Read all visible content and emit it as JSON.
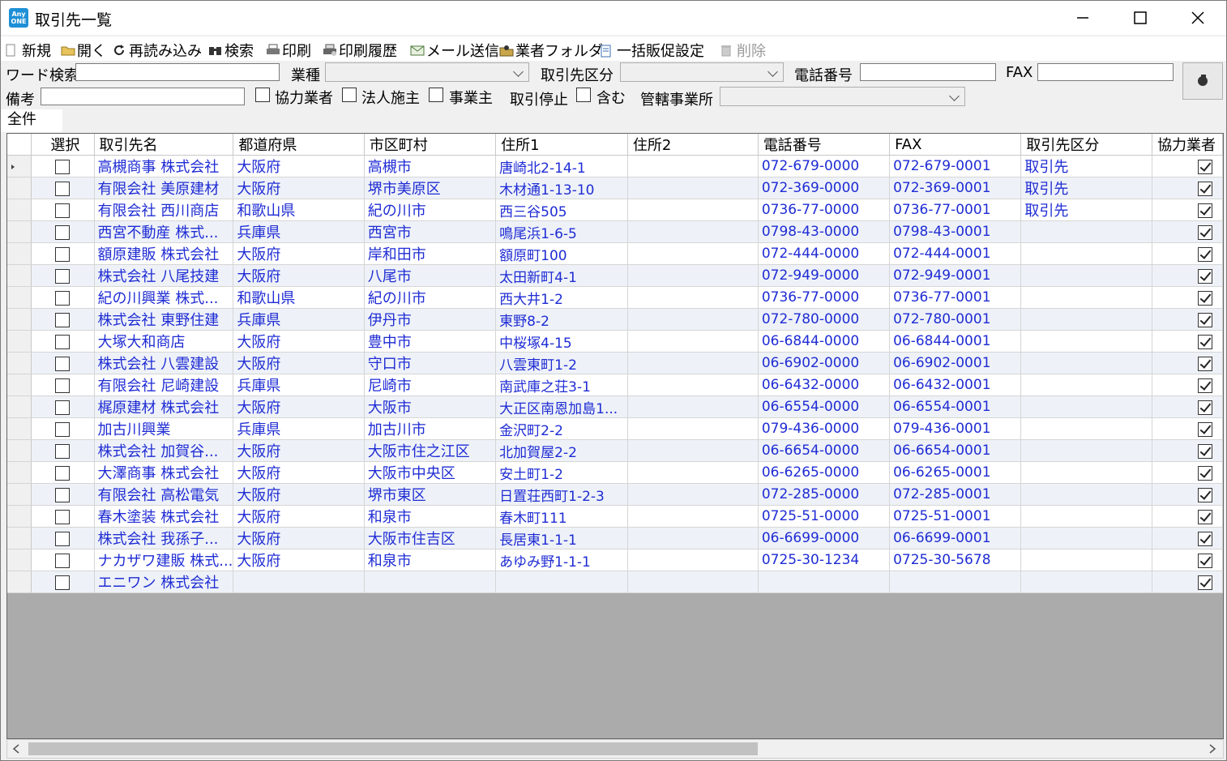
{
  "window": {
    "title": "取引先一覧",
    "app_icon_text": "Any ONE"
  },
  "toolbar": [
    {
      "label": "新規",
      "icon": "new-icon",
      "enabled": true
    },
    {
      "label": "開く",
      "icon": "folder-open-icon",
      "enabled": true
    },
    {
      "label": "再読み込み",
      "icon": "refresh-icon",
      "enabled": true
    },
    {
      "label": "検索",
      "icon": "binoculars-icon",
      "enabled": true
    },
    {
      "label": "印刷",
      "icon": "printer-icon",
      "enabled": true
    },
    {
      "label": "印刷履歴",
      "icon": "print-history-icon",
      "enabled": true
    },
    {
      "label": "メール送信",
      "icon": "mail-icon",
      "enabled": true
    },
    {
      "label": "業者フォルダ",
      "icon": "vendor-folder-icon",
      "enabled": true
    },
    {
      "label": "一括販促設定",
      "icon": "bulk-promo-icon",
      "enabled": true
    },
    {
      "label": "削除",
      "icon": "trash-icon",
      "enabled": false
    }
  ],
  "filters": {
    "word_search_label": "ワード検索",
    "word_search_value": "",
    "industry_label": "業種",
    "industry_value": "",
    "category_label": "取引先区分",
    "category_value": "",
    "phone_label": "電話番号",
    "phone_value": "",
    "fax_label": "FAX",
    "fax_value": "",
    "notes_label": "備考",
    "notes_value": "",
    "partner_label": "協力業者",
    "partner_checked": false,
    "corporate_label": "法人施主",
    "corporate_checked": false,
    "business_label": "事業主",
    "business_checked": false,
    "suspended_label": "取引停止",
    "include_label": "含む",
    "include_checked": false,
    "office_label": "管轄事業所",
    "office_value": ""
  },
  "tab": {
    "label": "全件"
  },
  "table": {
    "columns": [
      "選択",
      "取引先名",
      "都道府県",
      "市区町村",
      "住所1",
      "住所2",
      "電話番号",
      "FAX",
      "取引先区分",
      "協力業者"
    ],
    "rows": [
      {
        "selected": false,
        "name": "高槻商事 株式会社",
        "pref": "大阪府",
        "city": "高槻市",
        "addr1": "唐崎北2-14-1",
        "addr2": "",
        "tel": "072-679-0000",
        "fax": "072-679-0001",
        "category": "取引先",
        "partner": true
      },
      {
        "selected": false,
        "name": "有限会社 美原建材",
        "pref": "大阪府",
        "city": "堺市美原区",
        "addr1": "木材通1-13-10",
        "addr2": "",
        "tel": "072-369-0000",
        "fax": "072-369-0001",
        "category": "取引先",
        "partner": true
      },
      {
        "selected": false,
        "name": "有限会社 西川商店",
        "pref": "和歌山県",
        "city": "紀の川市",
        "addr1": "西三谷505",
        "addr2": "",
        "tel": "0736-77-0000",
        "fax": "0736-77-0001",
        "category": "取引先",
        "partner": true
      },
      {
        "selected": false,
        "name": "西宮不動産 株式...",
        "pref": "兵庫県",
        "city": "西宮市",
        "addr1": "鳴尾浜1-6-5",
        "addr2": "",
        "tel": "0798-43-0000",
        "fax": "0798-43-0001",
        "category": "",
        "partner": true
      },
      {
        "selected": false,
        "name": "額原建販 株式会社",
        "pref": "大阪府",
        "city": "岸和田市",
        "addr1": "額原町100",
        "addr2": "",
        "tel": "072-444-0000",
        "fax": "072-444-0001",
        "category": "",
        "partner": true
      },
      {
        "selected": false,
        "name": "株式会社 八尾技建",
        "pref": "大阪府",
        "city": "八尾市",
        "addr1": "太田新町4-1",
        "addr2": "",
        "tel": "072-949-0000",
        "fax": "072-949-0001",
        "category": "",
        "partner": true
      },
      {
        "selected": false,
        "name": "紀の川興業 株式...",
        "pref": "和歌山県",
        "city": "紀の川市",
        "addr1": "西大井1-2",
        "addr2": "",
        "tel": "0736-77-0000",
        "fax": "0736-77-0001",
        "category": "",
        "partner": true
      },
      {
        "selected": false,
        "name": "株式会社 東野住建",
        "pref": "兵庫県",
        "city": "伊丹市",
        "addr1": "東野8-2",
        "addr2": "",
        "tel": "072-780-0000",
        "fax": "072-780-0001",
        "category": "",
        "partner": true
      },
      {
        "selected": false,
        "name": "大塚大和商店",
        "pref": "大阪府",
        "city": "豊中市",
        "addr1": "中桜塚4-15",
        "addr2": "",
        "tel": "06-6844-0000",
        "fax": "06-6844-0001",
        "category": "",
        "partner": true
      },
      {
        "selected": false,
        "name": "株式会社 八雲建設",
        "pref": "大阪府",
        "city": "守口市",
        "addr1": "八雲東町1-2",
        "addr2": "",
        "tel": "06-6902-0000",
        "fax": "06-6902-0001",
        "category": "",
        "partner": true
      },
      {
        "selected": false,
        "name": "有限会社 尼崎建設",
        "pref": "兵庫県",
        "city": "尼崎市",
        "addr1": "南武庫之荘3-1",
        "addr2": "",
        "tel": "06-6432-0000",
        "fax": "06-6432-0001",
        "category": "",
        "partner": true
      },
      {
        "selected": false,
        "name": "梶原建材 株式会社",
        "pref": "大阪府",
        "city": "大阪市",
        "addr1": "大正区南恩加島1...",
        "addr2": "",
        "tel": "06-6554-0000",
        "fax": "06-6554-0001",
        "category": "",
        "partner": true
      },
      {
        "selected": false,
        "name": "加古川興業",
        "pref": "兵庫県",
        "city": "加古川市",
        "addr1": "金沢町2-2",
        "addr2": "",
        "tel": "079-436-0000",
        "fax": "079-436-0001",
        "category": "",
        "partner": true
      },
      {
        "selected": false,
        "name": "株式会社 加賀谷...",
        "pref": "大阪府",
        "city": "大阪市住之江区",
        "addr1": "北加賀屋2-2",
        "addr2": "",
        "tel": "06-6654-0000",
        "fax": "06-6654-0001",
        "category": "",
        "partner": true
      },
      {
        "selected": false,
        "name": "大澤商事 株式会社",
        "pref": "大阪府",
        "city": "大阪市中央区",
        "addr1": "安土町1-2",
        "addr2": "",
        "tel": "06-6265-0000",
        "fax": "06-6265-0001",
        "category": "",
        "partner": true
      },
      {
        "selected": false,
        "name": "有限会社 高松電気",
        "pref": "大阪府",
        "city": "堺市東区",
        "addr1": "日置荘西町1-2-3",
        "addr2": "",
        "tel": "072-285-0000",
        "fax": "072-285-0001",
        "category": "",
        "partner": true
      },
      {
        "selected": false,
        "name": "春木塗装 株式会社",
        "pref": "大阪府",
        "city": "和泉市",
        "addr1": "春木町111",
        "addr2": "",
        "tel": "0725-51-0000",
        "fax": "0725-51-0001",
        "category": "",
        "partner": true
      },
      {
        "selected": false,
        "name": "株式会社 我孫子...",
        "pref": "大阪府",
        "city": "大阪市住吉区",
        "addr1": "長居東1-1-1",
        "addr2": "",
        "tel": "06-6699-0000",
        "fax": "06-6699-0001",
        "category": "",
        "partner": true
      },
      {
        "selected": false,
        "name": "ナカザワ建販 株式...",
        "pref": "大阪府",
        "city": "和泉市",
        "addr1": "あゆみ野1-1-1",
        "addr2": "",
        "tel": "0725-30-1234",
        "fax": "0725-30-5678",
        "category": "",
        "partner": true
      },
      {
        "selected": false,
        "name": "エニワン 株式会社",
        "pref": "",
        "city": "",
        "addr1": "",
        "addr2": "",
        "tel": "",
        "fax": "",
        "category": "",
        "partner": true
      }
    ]
  }
}
